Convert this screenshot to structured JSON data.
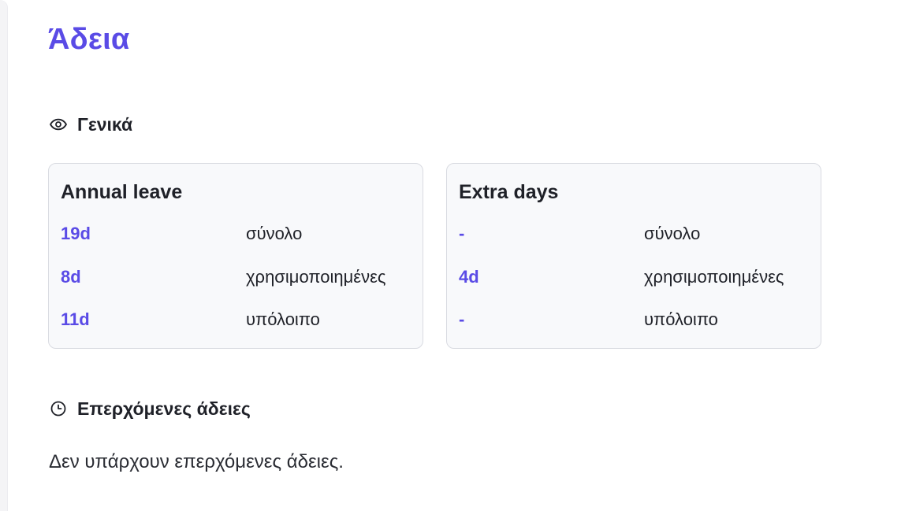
{
  "page": {
    "title": "Άδεια"
  },
  "general": {
    "heading": "Γενικά",
    "icon": "eye-icon"
  },
  "cards": {
    "annual": {
      "title": "Annual leave",
      "rows": [
        {
          "value": "19d",
          "label": "σύνολο"
        },
        {
          "value": "8d",
          "label": "χρησιμοποιημένες"
        },
        {
          "value": "11d",
          "label": "υπόλοιπο"
        }
      ]
    },
    "extra": {
      "title": "Extra days",
      "rows": [
        {
          "value": "-",
          "label": "σύνολο"
        },
        {
          "value": "4d",
          "label": "χρησιμοποιημένες"
        },
        {
          "value": "-",
          "label": "υπόλοιπο"
        }
      ]
    }
  },
  "upcoming": {
    "heading": "Επερχόμενες άδειες",
    "icon": "clock-icon",
    "empty_message": "Δεν υπάρχουν επερχόμενες άδειες."
  },
  "colors": {
    "accent": "#5a4be6",
    "text": "#1f2128",
    "card_background": "#f8f9fb",
    "card_border": "#d9dbe1"
  }
}
